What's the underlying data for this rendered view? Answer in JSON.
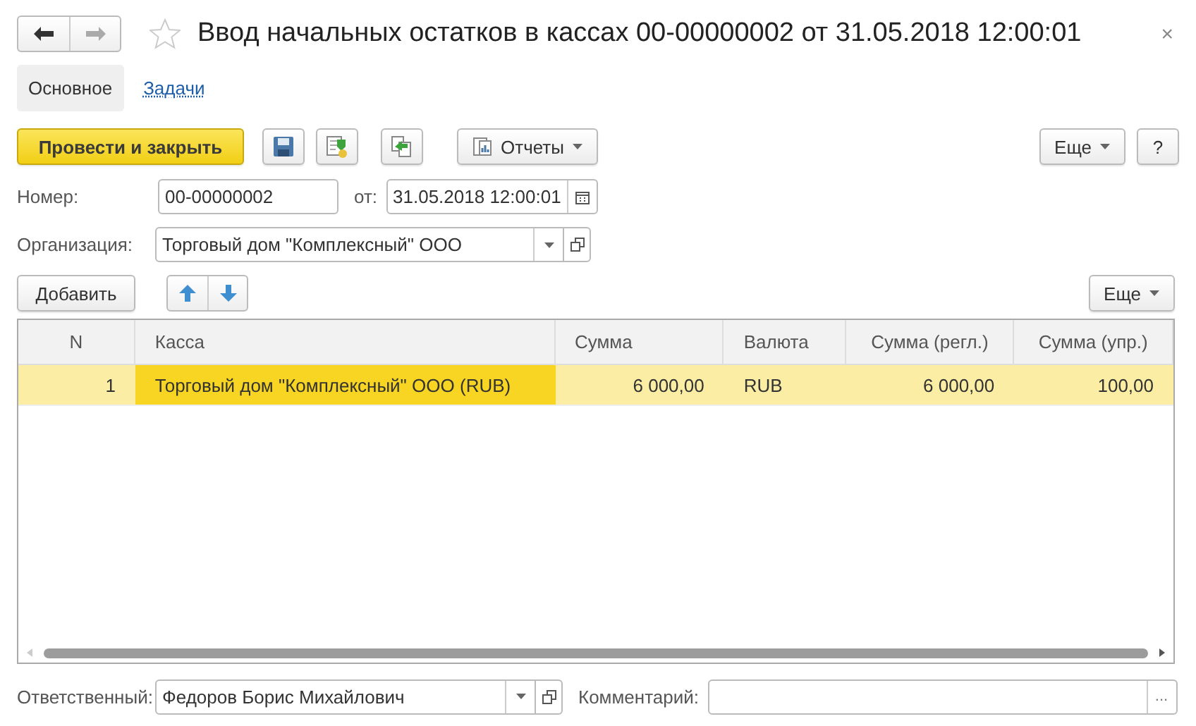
{
  "window": {
    "title": "Ввод начальных остатков в кассах 00-00000002 от 31.05.2018 12:00:01",
    "close": "×"
  },
  "tabs": [
    {
      "label": "Основное",
      "selected": true
    },
    {
      "label": "Задачи",
      "selected": false
    }
  ],
  "toolbar": {
    "primary": "Провести и закрыть",
    "reports": "Отчеты",
    "more": "Еще",
    "help": "?"
  },
  "fields": {
    "number_label": "Номер:",
    "number": "00-00000002",
    "date_label": "от:",
    "date": "31.05.2018 12:00:01",
    "org_label": "Организация:",
    "org": "Торговый дом \"Комплексный\" ООО"
  },
  "table_toolbar": {
    "add": "Добавить",
    "more": "Еще"
  },
  "table": {
    "columns": [
      "N",
      "Касса",
      "Сумма",
      "Валюта",
      "Сумма (регл.)",
      "Сумма (упр.)"
    ],
    "rows": [
      {
        "selected": true,
        "cells": [
          {
            "text": "1",
            "current": false
          },
          {
            "text": "Торговый дом \"Комплексный\" ООО (RUB)",
            "current": true
          },
          {
            "text": "6 000,00",
            "current": false
          },
          {
            "text": "RUB",
            "current": false
          },
          {
            "text": "6 000,00",
            "current": false
          },
          {
            "text": "100,00",
            "current": false
          }
        ]
      }
    ]
  },
  "footer": {
    "responsible_label": "Ответственный:",
    "responsible": "Федоров Борис Михайлович",
    "comment_label": "Комментарий:",
    "comment_button": "..."
  }
}
